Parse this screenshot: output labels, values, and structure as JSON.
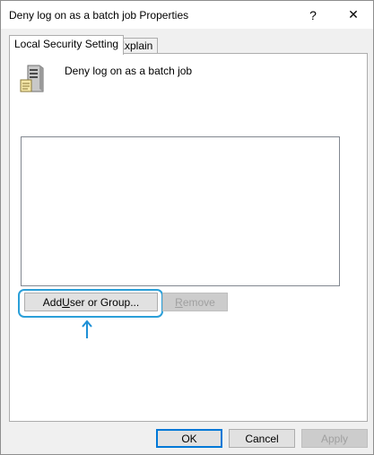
{
  "window": {
    "title": "Deny log on as a batch job Properties",
    "help_glyph": "?",
    "close_glyph": "✕"
  },
  "tabs": [
    {
      "label": "Local Security Setting",
      "active": true
    },
    {
      "label": "Explain",
      "active": false
    }
  ],
  "policy": {
    "name": "Deny log on as a batch job",
    "icon": "server-icon"
  },
  "accounts_list": [],
  "buttons": {
    "add_prefix": "Add ",
    "add_mnemonic": "U",
    "add_suffix": "ser or Group...",
    "remove_mnemonic": "R",
    "remove_suffix": "emove",
    "ok": "OK",
    "cancel": "Cancel",
    "apply": "Apply"
  },
  "annotation": {
    "ring_color": "#2a9fd8",
    "arrow_color": "#1e90d6",
    "arrow_icon": "arrow-up-icon"
  },
  "colors": {
    "default_button_border": "#0078d7",
    "disabled_text": "#a0a0a0"
  }
}
